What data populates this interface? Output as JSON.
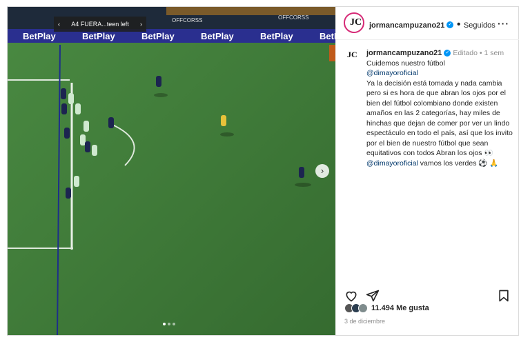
{
  "post": {
    "username": "jormancampuzano21",
    "follow_state": "Seguidos",
    "edited_label": "Editado",
    "time_ago": "1 sem",
    "caption_line1": "Cuidemos nuestro fútbol",
    "mention1": "@dimayoroficial",
    "caption_body": "Ya la decisión está tomada y nada cambia pero si es hora de que abran los ojos por el bien del fútbol colombiano donde existen amaños en las 2 categorías, hay miles de hinchas que dejan de comer por ver un lindo espectáculo en todo el país, así que los invito por el bien de nuestro fútbol que sean equitativos con todos Abran los ojos 👀",
    "mention2": "@dimayoroficial",
    "caption_tail": "vamos los verdes ⚽ 🙏",
    "likes": "11.494 Me gusta",
    "date": "3 de diciembre"
  },
  "media": {
    "var_label": "A4 FUERA...teen left",
    "ad_text": "BetPlay",
    "board_text": "OFFCORSS",
    "carousel_total": 3,
    "carousel_active": 1
  },
  "colors": {
    "pitch": "#3f7d3a",
    "accent": "#0095f6",
    "mention": "#00376b"
  }
}
